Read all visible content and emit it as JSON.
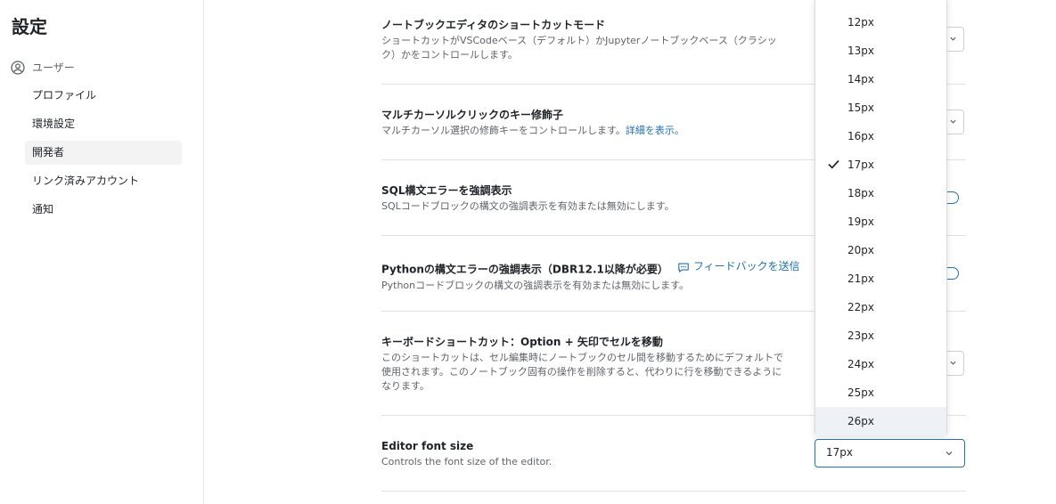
{
  "sidebar": {
    "title": "設定",
    "group_label": "ユーザー",
    "items": [
      {
        "label": "プロファイル"
      },
      {
        "label": "環境設定"
      },
      {
        "label": "開発者"
      },
      {
        "label": "リンク済みアカウント"
      },
      {
        "label": "通知"
      }
    ],
    "active_item": "開発者"
  },
  "settings": [
    {
      "title": "ノートブックエディタのショートカットモード",
      "description": "ショートカットがVSCodeベース（デフォルト）かJupyterノートブックベース（クラシック）かをコントロールします。"
    },
    {
      "title": "マルチカーソルクリックのキー修飾子",
      "description": "マルチカーソル選択の修飾キーをコントロールします。",
      "link": "詳細を表示。"
    },
    {
      "title": "SQL構文エラーを強調表示",
      "description": "SQLコードブロックの構文の強調表示を有効または無効にします。"
    },
    {
      "title": "Pythonの構文エラーの強調表示（DBR12.1以降が必要）",
      "feedback": "フィードバックを送信",
      "description": "Pythonコードブロックの構文の強調表示を有効または無効にします。"
    },
    {
      "title": "キーボードショートカット：Option + 矢印でセルを移動",
      "description": "このショートカットは、セル編集時にノートブックのセル間を移動するためにデフォルトで使用されます。このノートブック固有の操作を削除すると、代わりに行を移動できるようになります。"
    },
    {
      "title": "Editor font size",
      "description": "Controls the font size of the editor."
    }
  ],
  "font_size_select": {
    "value": "17px",
    "options": [
      "12px",
      "13px",
      "14px",
      "15px",
      "16px",
      "17px",
      "18px",
      "19px",
      "20px",
      "21px",
      "22px",
      "23px",
      "24px",
      "25px",
      "26px"
    ],
    "selected": "17px",
    "hovered": "26px"
  },
  "colors": {
    "accent": "#2272b4",
    "hover": "#eef2f6"
  }
}
